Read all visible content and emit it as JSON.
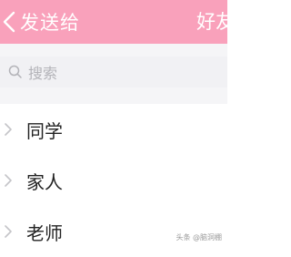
{
  "header": {
    "back_icon": "chevron-left-icon",
    "title": "发送给",
    "right_label": "好友",
    "background_color": "#f9a1bb"
  },
  "search": {
    "icon": "search-icon",
    "placeholder": "搜索"
  },
  "groups": {
    "items": [
      {
        "label": "同学",
        "icon": "chevron-right-icon"
      },
      {
        "label": "家人",
        "icon": "chevron-right-icon"
      },
      {
        "label": "老师",
        "icon": "chevron-right-icon"
      }
    ]
  },
  "watermark": {
    "text": "头条 @脑洞棚"
  }
}
